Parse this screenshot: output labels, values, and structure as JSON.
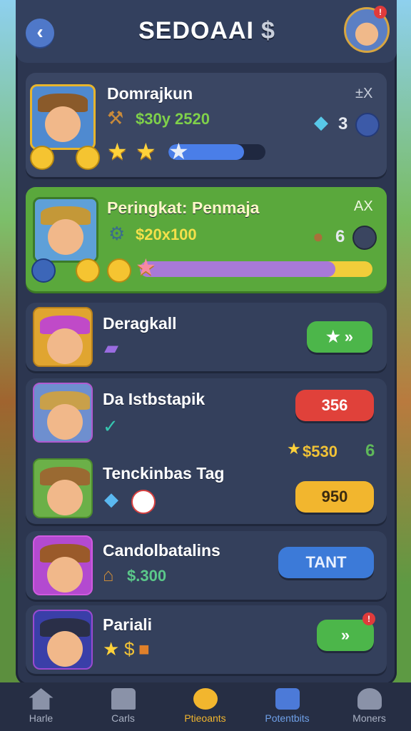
{
  "header": {
    "title": "SEDOAAI",
    "currency_symbol": "$"
  },
  "cards": [
    {
      "name": "Domrajkun",
      "money": "$30y 2520",
      "count": "3"
    },
    {
      "name": "Peringkat: Penmaja",
      "money": "$20x100",
      "count": "6"
    },
    {
      "name": "Deragkall"
    },
    {
      "name": "Da Istbstapik",
      "button": "356"
    },
    {
      "name": "Tenckinbas Tag",
      "reward": "$530",
      "reward_count": "6",
      "button": "950"
    },
    {
      "name": "Candolbatalins",
      "money": "$.300",
      "button": "TANT"
    },
    {
      "name": "Pariali"
    }
  ],
  "close_labels": [
    "±X",
    "AX"
  ],
  "nav": [
    "Harle",
    "Carls",
    "Ptieoants",
    "Potentbits",
    "Moners"
  ],
  "colors": {
    "panel": "#2c3650",
    "green": "#5aa83c",
    "accent": "#f2b62e"
  }
}
